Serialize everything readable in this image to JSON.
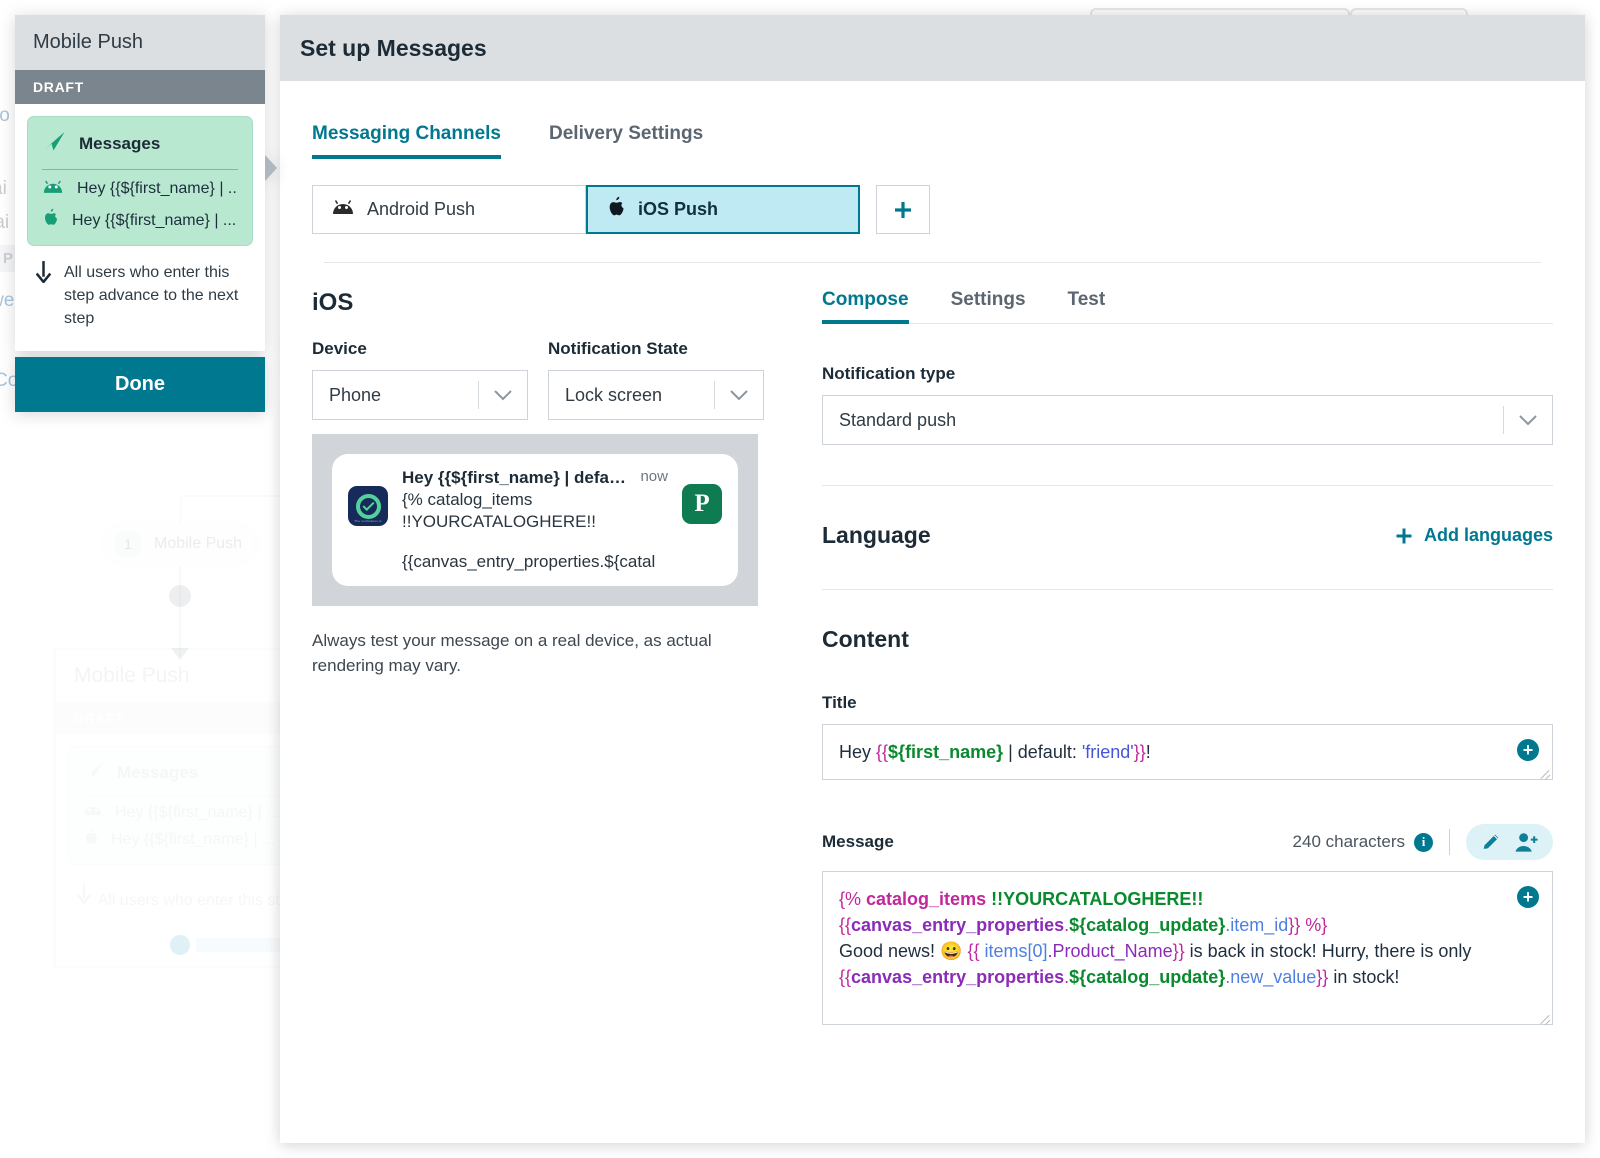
{
  "background": {
    "edge_words": [
      "to",
      "ai",
      "rai",
      "we",
      "Co"
    ],
    "edge_chip": "P",
    "node": {
      "number": "1",
      "label": "Mobile Push"
    },
    "panel": {
      "title": "Mobile Push",
      "status": "DRAFT",
      "card_title": "Messages",
      "messages": [
        "Hey {{${first_name} | ...",
        "Hey {{${first_name} | ..."
      ],
      "footer": "All users who enter this step advance to the next step"
    }
  },
  "step_panel": {
    "title": "Mobile Push",
    "status": "DRAFT",
    "card_title": "Messages",
    "messages": [
      {
        "platform": "android-icon",
        "text": "Hey {{${first_name} | ..."
      },
      {
        "platform": "apple-icon",
        "text": "Hey {{${first_name} | ..."
      }
    ],
    "footer": "All users who enter this step advance to the next step",
    "done_label": "Done"
  },
  "modal": {
    "title": "Set up Messages",
    "tabs": [
      {
        "label": "Messaging Channels",
        "active": true
      },
      {
        "label": "Delivery Settings",
        "active": false
      }
    ],
    "channels": [
      {
        "label": "Android Push",
        "icon": "android-icon",
        "active": false
      },
      {
        "label": "iOS Push",
        "icon": "apple-icon",
        "active": true
      }
    ],
    "add_channel_label": "+"
  },
  "preview": {
    "os_heading": "iOS",
    "device": {
      "label": "Device",
      "value": "Phone"
    },
    "notification_state": {
      "label": "Notification State",
      "value": "Lock screen"
    },
    "notification": {
      "title": "Hey {{${first_name} | default: 'frien...",
      "line1": "{% catalog_items",
      "line2": "!!YOURCATALOGHERE!!",
      "line3": "{{canvas_entry_properties.${catal",
      "time": "now",
      "thumb_letter": "P"
    },
    "note": "Always test your message on a real device, as actual rendering may vary."
  },
  "compose": {
    "tabs": [
      {
        "label": "Compose",
        "active": true
      },
      {
        "label": "Settings",
        "active": false
      },
      {
        "label": "Test",
        "active": false
      }
    ],
    "notification_type": {
      "label": "Notification type",
      "value": "Standard push"
    },
    "language": {
      "heading": "Language",
      "add_label": "Add languages"
    },
    "content_heading": "Content",
    "title_field": {
      "label": "Title",
      "segments": [
        {
          "t": "Hey ",
          "c": "lq-plain"
        },
        {
          "t": "{{",
          "c": "lq-brace"
        },
        {
          "t": "${first_name}",
          "c": "lq-green"
        },
        {
          "t": " | default: ",
          "c": "lq-plain"
        },
        {
          "t": "'friend'",
          "c": "lq-blue"
        },
        {
          "t": "}}",
          "c": "lq-brace"
        },
        {
          "t": "!",
          "c": "lq-plain"
        }
      ]
    },
    "message_field": {
      "label": "Message",
      "char_count": "240 characters",
      "segments": [
        {
          "t": "{%",
          "c": "lq-brace"
        },
        {
          "t": " catalog_items ",
          "c": "lq-tag"
        },
        {
          "t": "!!YOURCATALOGHERE!!",
          "c": "lq-green-b"
        },
        {
          "t": "\n",
          "c": "br"
        },
        {
          "t": "{{",
          "c": "lq-brace"
        },
        {
          "t": "canvas_entry_properties",
          "c": "lq-purple"
        },
        {
          "t": ".",
          "c": "lq-brace"
        },
        {
          "t": "${catalog_update}",
          "c": "lq-green-b"
        },
        {
          "t": ".item_id",
          "c": "lq-blue2"
        },
        {
          "t": "}}",
          "c": "lq-brace"
        },
        {
          "t": " %}",
          "c": "lq-brace"
        },
        {
          "t": "\n",
          "c": "br"
        },
        {
          "t": "Good news! 😀 ",
          "c": "lq-plain"
        },
        {
          "t": "{{",
          "c": "lq-brace"
        },
        {
          "t": " items[0]",
          "c": "lq-blue2"
        },
        {
          "t": ".Product_Name",
          "c": "lq-purple-thin"
        },
        {
          "t": "}}",
          "c": "lq-brace"
        },
        {
          "t": " is back in stock! Hurry, there is only ",
          "c": "lq-plain"
        },
        {
          "t": "{{",
          "c": "lq-brace"
        },
        {
          "t": "canvas_entry_properties",
          "c": "lq-purple"
        },
        {
          "t": ".",
          "c": "lq-brace"
        },
        {
          "t": "${catalog_update}",
          "c": "lq-green-b"
        },
        {
          "t": ".new_value",
          "c": "lq-blue2"
        },
        {
          "t": "}}",
          "c": "lq-brace"
        },
        {
          "t": " in stock!",
          "c": "lq-plain"
        }
      ],
      "icons": [
        "pencil-icon",
        "add-person-icon"
      ]
    }
  },
  "colors": {
    "accent": "#00788f",
    "selected_channel_bg": "#bfeaf3",
    "header_bg": "#dcdfe2",
    "draft_bg": "#7b858d",
    "card_bg": "#b9e8d1"
  }
}
